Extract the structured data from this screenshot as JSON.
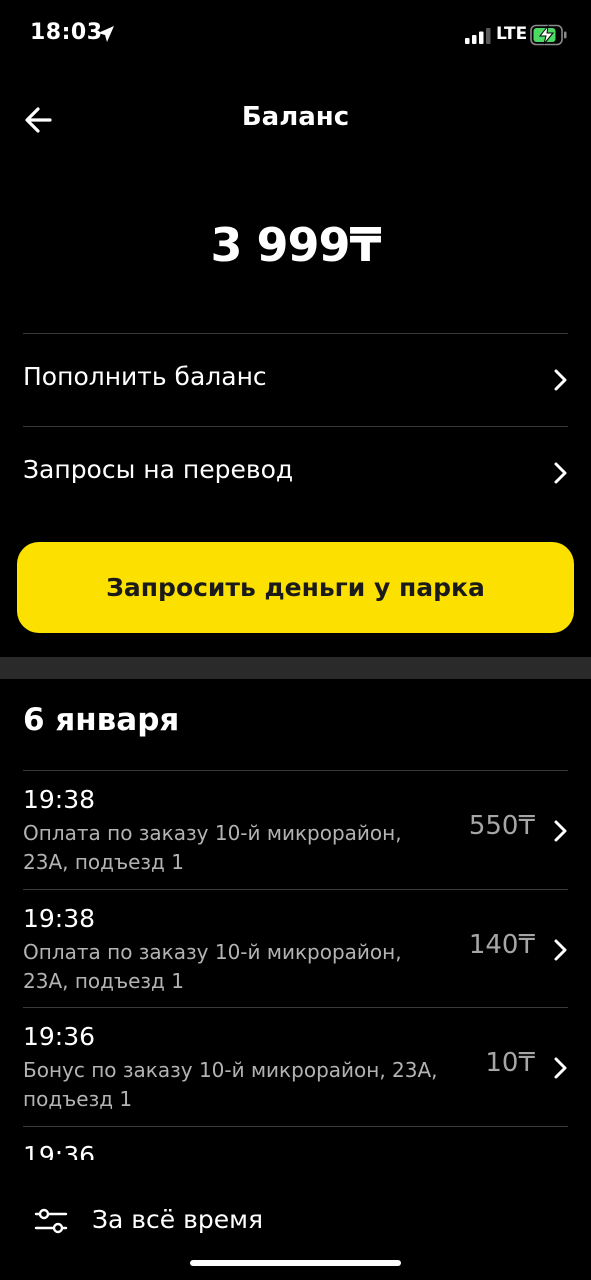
{
  "status_bar": {
    "time": "18:03",
    "network": "LTE"
  },
  "header": {
    "title": "Баланс"
  },
  "balance": {
    "amount": "3 999₸"
  },
  "menu": [
    {
      "label": "Пополнить баланс"
    },
    {
      "label": "Запросы на перевод"
    }
  ],
  "primary_button": {
    "label": "Запросить деньги у парка"
  },
  "transactions_section": {
    "date": "6 января",
    "items": [
      {
        "time": "19:38",
        "description": "Оплата по заказу 10-й микрорайон, 23А, подъезд 1",
        "amount": "550₸"
      },
      {
        "time": "19:38",
        "description": "Оплата по заказу 10-й микрорайон, 23А, подъезд 1",
        "amount": "140₸"
      },
      {
        "time": "19:36",
        "description": "Бонус по заказу 10-й микрорайон, 23А, подъезд 1",
        "amount": "10₸"
      },
      {
        "time": "19:36"
      }
    ]
  },
  "filter": {
    "label": "За всё время"
  },
  "colors": {
    "background": "#000000",
    "accent": "#fce000",
    "secondary_text": "#b3b3b3",
    "battery_charging": "#4cd964"
  }
}
